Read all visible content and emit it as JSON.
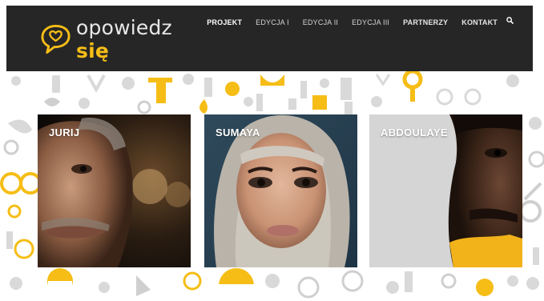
{
  "brand": {
    "name_main": "opowiedz ",
    "name_accent": "się",
    "accent_color": "#f5bd16",
    "header_bg": "#262626"
  },
  "nav": {
    "items": [
      {
        "label": "PROJEKT",
        "active": true
      },
      {
        "label": "EDYCJA I",
        "active": false
      },
      {
        "label": "EDYCJA II",
        "active": false
      },
      {
        "label": "EDYCJA III",
        "active": false
      },
      {
        "label": "PARTNERZY",
        "active": false
      },
      {
        "label": "KONTAKT",
        "active": false
      }
    ],
    "search_icon": "search-icon"
  },
  "cards": [
    {
      "name": "JURIJ"
    },
    {
      "name": "SUMAYA"
    },
    {
      "name": "ABDOULAYE"
    }
  ]
}
